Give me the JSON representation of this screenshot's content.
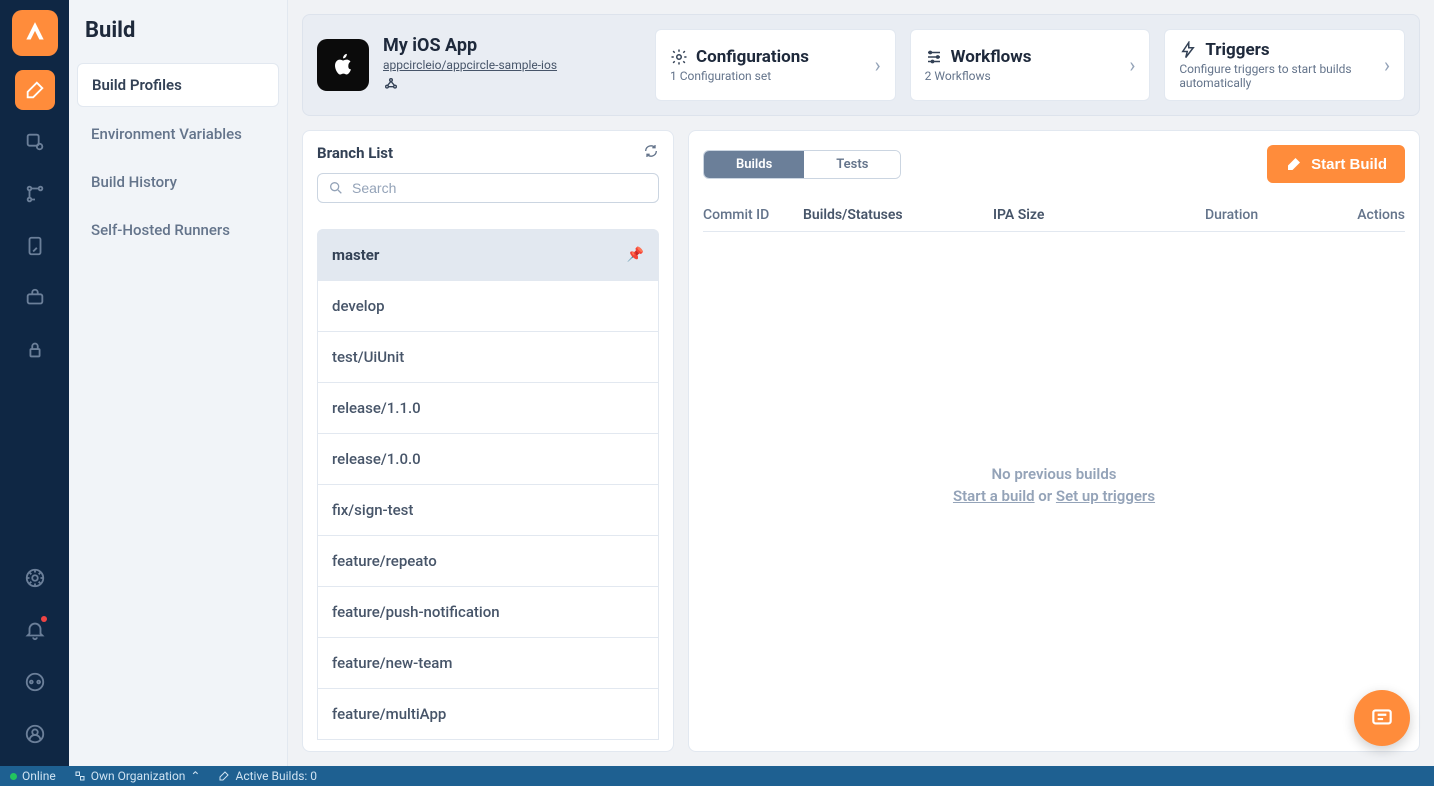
{
  "sidebar": {
    "title": "Build",
    "items": [
      {
        "label": "Build Profiles",
        "active": true
      },
      {
        "label": "Environment Variables",
        "active": false
      },
      {
        "label": "Build History",
        "active": false
      },
      {
        "label": "Self-Hosted Runners",
        "active": false
      }
    ]
  },
  "header": {
    "app_name": "My iOS App",
    "repo": "appcircleio/appcircle-sample-ios",
    "cards": [
      {
        "title": "Configurations",
        "subtitle": "1 Configuration set"
      },
      {
        "title": "Workflows",
        "subtitle": "2 Workflows"
      },
      {
        "title": "Triggers",
        "subtitle": "Configure triggers to start builds automatically"
      }
    ]
  },
  "branches": {
    "title": "Branch List",
    "search_placeholder": "Search",
    "items": [
      {
        "name": "master",
        "active": true
      },
      {
        "name": "develop",
        "active": false
      },
      {
        "name": "test/UiUnit",
        "active": false
      },
      {
        "name": "release/1.1.0",
        "active": false
      },
      {
        "name": "release/1.0.0",
        "active": false
      },
      {
        "name": "fix/sign-test",
        "active": false
      },
      {
        "name": "feature/repeato",
        "active": false
      },
      {
        "name": "feature/push-notification",
        "active": false
      },
      {
        "name": "feature/new-team",
        "active": false
      },
      {
        "name": "feature/multiApp",
        "active": false
      }
    ]
  },
  "builds": {
    "tabs": {
      "builds": "Builds",
      "tests": "Tests"
    },
    "start_button": "Start Build",
    "columns": {
      "commit": "Commit ID",
      "status": "Builds/Statuses",
      "size": "IPA Size",
      "duration": "Duration",
      "actions": "Actions"
    },
    "empty": {
      "line1": "No previous builds",
      "start_link": "Start a build",
      "or": " or ",
      "triggers_link": "Set up triggers"
    }
  },
  "footer": {
    "online": "Online",
    "org": "Own Organization",
    "active_builds": "Active Builds: 0"
  }
}
